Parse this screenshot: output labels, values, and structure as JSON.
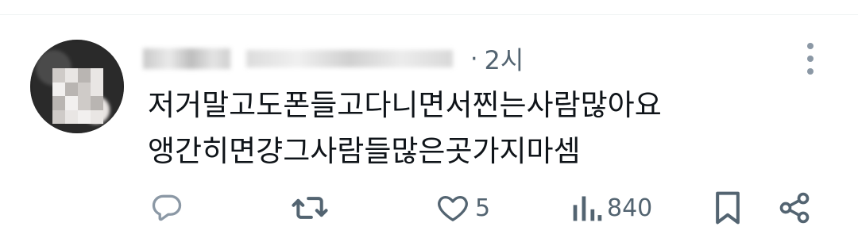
{
  "post": {
    "time": "2시",
    "separator": "·",
    "lines": [
      "저거말고도폰들고다니면서찐는사람많아요",
      "앵간히면걍그사람들많은곳가지마셈"
    ]
  },
  "actions": {
    "reply_count": "",
    "repost_count": "",
    "like_count": "5",
    "views_count": "840"
  },
  "icons": {
    "reply": "speech-bubble-icon",
    "repost": "repost-arrows-icon",
    "like": "heart-icon",
    "views": "bar-chart-icon",
    "bookmark": "bookmark-icon",
    "share": "share-icon",
    "more": "vertical-dots-icon"
  },
  "colors": {
    "muted": "#536471",
    "text": "#0f1419",
    "divider": "#eff3f4"
  }
}
